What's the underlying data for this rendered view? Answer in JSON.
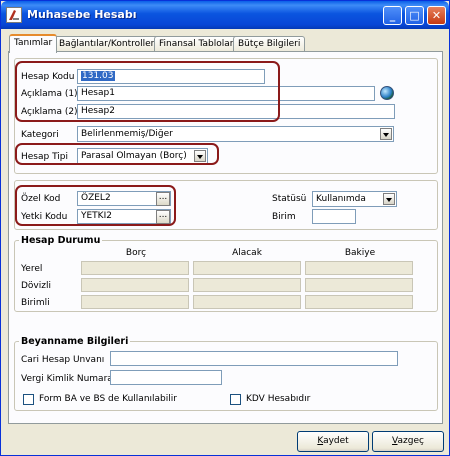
{
  "window": {
    "title": "Muhasebe Hesabı",
    "controls": {
      "minimize": "_",
      "maximize": "□",
      "close": "✕"
    }
  },
  "tabs": [
    {
      "label": "Tanımlar",
      "active": true
    },
    {
      "label": "Bağlantılar/Kontroller",
      "active": false
    },
    {
      "label": "Finansal Tablolar",
      "active": false
    },
    {
      "label": "Bütçe Bilgileri",
      "active": false
    }
  ],
  "main": {
    "hesap_kodu": {
      "label": "Hesap Kodu",
      "value": "131.03"
    },
    "aciklama1": {
      "label": "Açıklama (1)",
      "value": "Hesap1"
    },
    "aciklama2": {
      "label": "Açıklama (2)",
      "value": "Hesap2"
    },
    "kategori": {
      "label": "Kategori",
      "value": "Belirlenmemiş/Diğer"
    },
    "hesap_tipi": {
      "label": "Hesap Tipi",
      "value": "Parasal Olmayan (Borç)"
    }
  },
  "codes": {
    "ozel_kod": {
      "label": "Özel Kod",
      "value": "ÖZEL2",
      "button": "..."
    },
    "yetki_kodu": {
      "label": "Yetki Kodu",
      "value": "YETKI2",
      "button": "..."
    },
    "statusu": {
      "label": "Statüsü",
      "value": "Kullanımda"
    },
    "birim": {
      "label": "Birim",
      "value": ""
    }
  },
  "hesap_durumu": {
    "title": "Hesap Durumu",
    "columns": [
      "Borç",
      "Alacak",
      "Bakiye"
    ],
    "rows": [
      "Yerel",
      "Dövizli",
      "Birimli"
    ]
  },
  "beyanname": {
    "title": "Beyanname Bilgileri",
    "cari_hesap_label": "Cari Hesap Unvanı",
    "cari_hesap_value": "",
    "vergi_label": "Vergi Kimlik Numarası",
    "vergi_value": "",
    "form_ba_bs_label": "Form BA ve BS de Kullanılabilir",
    "kdv_label": "KDV Hesabıdır"
  },
  "buttons": {
    "kaydet_accel": "K",
    "kaydet_rest": "aydet",
    "vazgec_accel": "V",
    "vazgec_rest": "azgeç"
  },
  "colors": {
    "title_bar": "#0846d6",
    "highlight_border": "#8b1a1a",
    "selection": "#316ac5"
  }
}
